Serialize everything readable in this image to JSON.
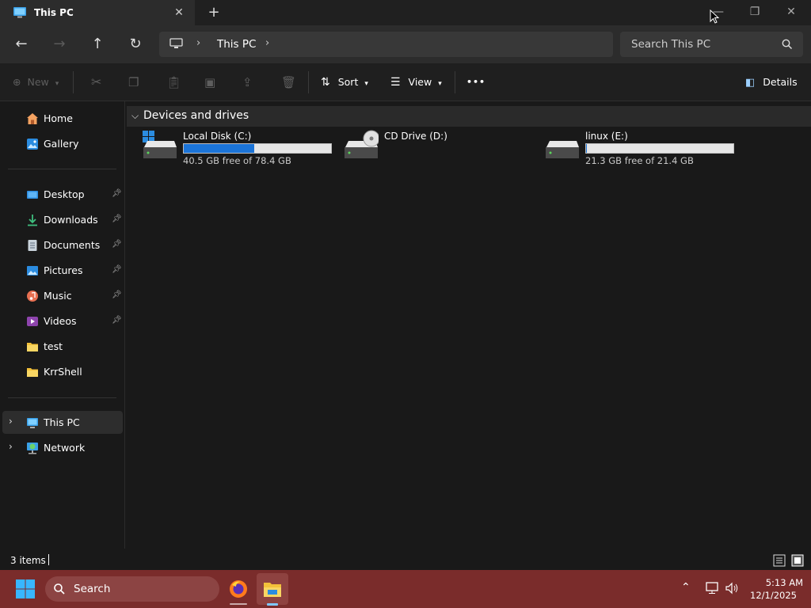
{
  "window": {
    "tab_title": "This PC",
    "tab_icon": "pc-monitor-icon",
    "controls": [
      "minimize-icon",
      "maximize-icon",
      "close-icon"
    ]
  },
  "nav": {
    "back": "←",
    "forward": "→",
    "up": "↑",
    "refresh": "↻",
    "breadcrumb": [
      "This PC"
    ],
    "search_placeholder": "Search This PC"
  },
  "toolbar": {
    "new_label": "New",
    "sort_label": "Sort",
    "view_label": "View",
    "more_label": "•••",
    "details_label": "Details"
  },
  "sidebar": {
    "top": [
      {
        "label": "Home",
        "icon": "home-icon"
      },
      {
        "label": "Gallery",
        "icon": "gallery-icon"
      }
    ],
    "quick": [
      {
        "label": "Desktop",
        "icon": "desktop-icon",
        "pinned": true
      },
      {
        "label": "Downloads",
        "icon": "download-icon",
        "pinned": true
      },
      {
        "label": "Documents",
        "icon": "documents-icon",
        "pinned": true
      },
      {
        "label": "Pictures",
        "icon": "pictures-icon",
        "pinned": true
      },
      {
        "label": "Music",
        "icon": "music-icon",
        "pinned": true
      },
      {
        "label": "Videos",
        "icon": "videos-icon",
        "pinned": true
      },
      {
        "label": "test",
        "icon": "folder-icon",
        "pinned": false
      },
      {
        "label": "KrrShell",
        "icon": "folder-icon",
        "pinned": false
      }
    ],
    "tree": [
      {
        "label": "This PC",
        "icon": "pc-icon",
        "selected": true
      },
      {
        "label": "Network",
        "icon": "network-icon",
        "selected": false
      }
    ]
  },
  "main": {
    "group_title": "Devices and drives",
    "drives": [
      {
        "name": "Local Disk (C:)",
        "free": "40.5 GB free of 78.4 GB",
        "used_fraction": 0.48,
        "icon": "windows-disk-icon"
      },
      {
        "name": "CD Drive (D:)",
        "free": "",
        "icon": "cd-drive-icon"
      },
      {
        "name": "linux (E:)",
        "free": "21.3 GB free of 21.4 GB",
        "used_fraction": 0.005,
        "icon": "disk-icon"
      }
    ]
  },
  "status": {
    "items": "3 items"
  },
  "taskbar": {
    "search_label": "Search",
    "time": "5:13 AM",
    "date": "12/1/2025",
    "colors": {
      "taskbar": "#7a2c2b",
      "accent": "#1b74d8"
    }
  }
}
